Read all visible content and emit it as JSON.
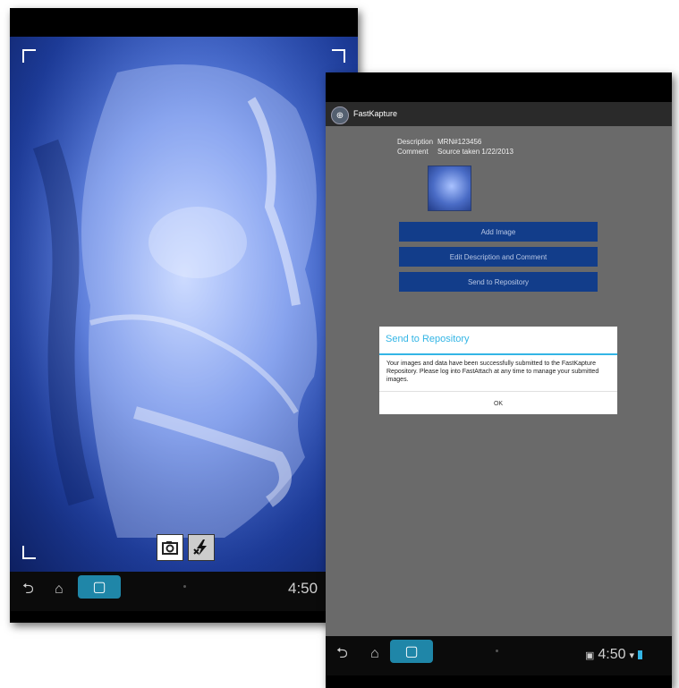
{
  "camera_screen": {
    "shutter_icon": "camera-icon",
    "flash_icon": "flash-off-icon",
    "clock": "4:50"
  },
  "app": {
    "title": "FastKapture",
    "description_label": "Description",
    "description_value": "MRN#123456",
    "comment_label": "Comment",
    "comment_value": "Source taken 1/22/2013",
    "buttons": [
      {
        "label": "Add Image"
      },
      {
        "label": "Edit Description and Comment"
      },
      {
        "label": "Send to Repository"
      }
    ],
    "dialog": {
      "title": "Send to Repository",
      "message": "Your images and data have been successfully submitted to the FastKapture Repository. Please log into FastAttach at any time to manage your submitted images.",
      "ok_label": "OK"
    },
    "clock": "4:50"
  },
  "colors": {
    "accent": "#33b5e5",
    "button": "#123d8a",
    "app_background": "#6a6a6a"
  }
}
